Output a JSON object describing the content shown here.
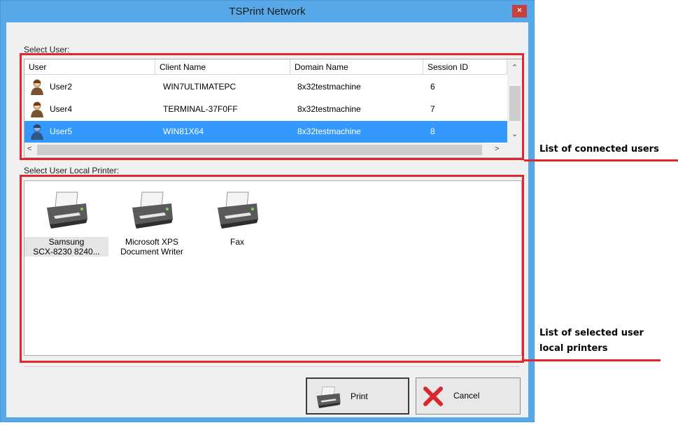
{
  "window": {
    "title": "TSPrint Network",
    "close_glyph": "×"
  },
  "users": {
    "label": "Select User:",
    "columns": [
      "User",
      "Client Name",
      "Domain Name",
      "Session ID"
    ],
    "rows": [
      {
        "user": "User2",
        "client": "WIN7ULTIMATEPC",
        "domain": "8x32testmachine",
        "session": "6",
        "selected": false
      },
      {
        "user": "User4",
        "client": "TERMINAL-37F0FF",
        "domain": "8x32testmachine",
        "session": "7",
        "selected": false
      },
      {
        "user": "User5",
        "client": "WIN81X64",
        "domain": "8x32testmachine",
        "session": "8",
        "selected": true
      }
    ]
  },
  "printers": {
    "label": "Select User Local Printer:",
    "items": [
      {
        "line1": "Samsung",
        "line2": "SCX-8230 8240...",
        "selected": true
      },
      {
        "line1": "Microsoft XPS",
        "line2": "Document Writer",
        "selected": false
      },
      {
        "line1": "Fax",
        "line2": "",
        "selected": false
      }
    ]
  },
  "buttons": {
    "print": "Print",
    "cancel": "Cancel"
  },
  "annotations": {
    "users": "List of connected users",
    "printers_line1": "List of selected user",
    "printers_line2": "local printers"
  },
  "colors": {
    "title_bar": "#57a8e8",
    "selection": "#3399ff",
    "annotation_red": "#e3262d",
    "close": "#c7423c"
  },
  "icons": [
    "user-icon",
    "printer-icon",
    "cancel-x-icon",
    "scroll-arrow-icons"
  ]
}
